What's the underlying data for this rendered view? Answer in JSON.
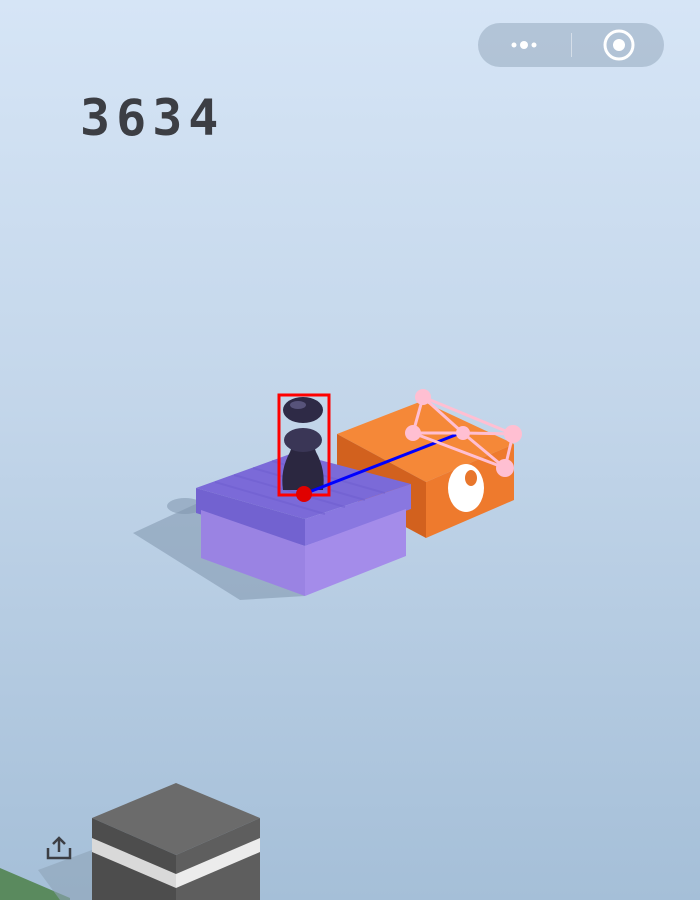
{
  "score": "3634",
  "capsule": {
    "more_icon": "more-dots-icon",
    "close_icon": "target-close-icon"
  },
  "share_icon": "share-icon",
  "colors": {
    "background_top": "#d6e5f6",
    "background_bottom": "#a5bfd8",
    "player": "#2e2a44",
    "current_block": "#9b86e6",
    "target_block": "#ef7d33",
    "next_block": "#6a6a6a",
    "detection_box": "#ff0000",
    "trajectory_line": "#0000ff",
    "keypoints": "#ffc0cb"
  }
}
